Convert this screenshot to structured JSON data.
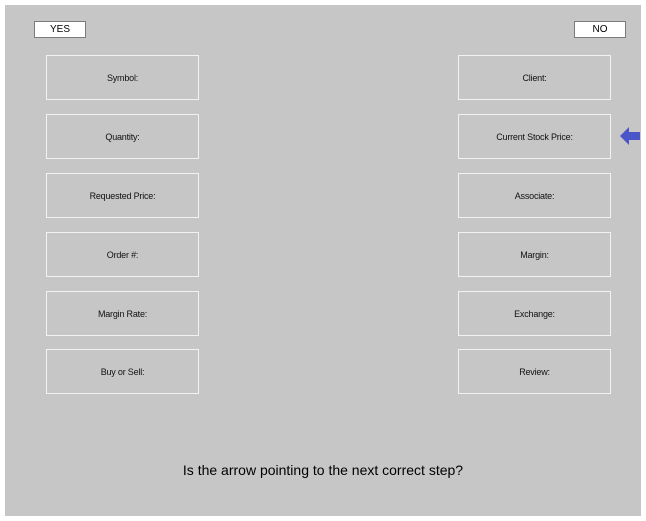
{
  "buttons": {
    "yes_label": "YES",
    "no_label": "NO"
  },
  "left_fields": [
    "Symbol:",
    "Quantity:",
    "Requested Price:",
    "Order #:",
    "Margin Rate:",
    "Buy or Sell:"
  ],
  "right_fields": [
    "Client:",
    "Current Stock Price:",
    "Associate:",
    "Margin:",
    "Exchange:",
    "Review:"
  ],
  "arrow": {
    "icon": "left-arrow-icon",
    "color": "#4a55c8",
    "points_to": "Current Stock Price:"
  },
  "question": "Is the arrow pointing to the next correct step?",
  "colors": {
    "background": "#c6c6c6",
    "field_border": "#f2f2f2",
    "arrow": "#4a55c8"
  }
}
